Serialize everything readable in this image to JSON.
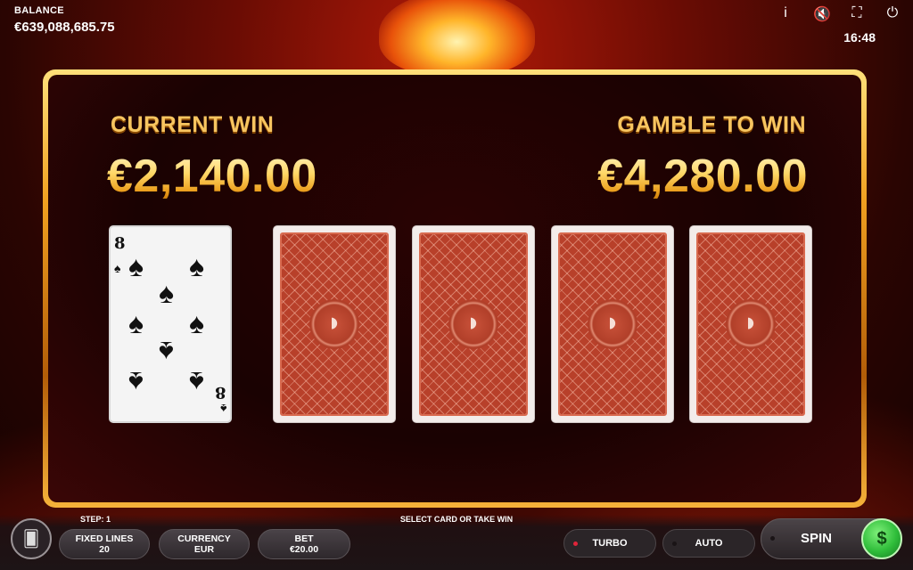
{
  "header": {
    "balance_label": "BALANCE",
    "balance_value": "€639,088,685.75",
    "clock": "16:48",
    "icons": [
      "info-icon",
      "sound-muted-icon",
      "fullscreen-icon",
      "power-icon"
    ],
    "icon_glyphs": [
      "i",
      "🔇",
      "⛶",
      "⏻"
    ]
  },
  "gamble": {
    "current_win_label": "CURRENT WIN",
    "current_win_value": "€2,140.00",
    "gamble_to_win_label": "GAMBLE TO WIN",
    "gamble_to_win_value": "€4,280.00",
    "dealer_card": {
      "rank": "8",
      "suit": "♠",
      "suit_name": "spades"
    },
    "face_down_cards": 4,
    "card_back_color": "#b8402a"
  },
  "footer": {
    "step": "STEP: 1",
    "hint": "SELECT CARD OR TAKE WIN",
    "fixed_lines_label": "FIXED LINES",
    "fixed_lines_value": "20",
    "currency_label": "CURRENCY",
    "currency_value": "EUR",
    "bet_label": "BET",
    "bet_value": "€20.00",
    "turbo_label": "TURBO",
    "auto_label": "AUTO",
    "spin_label": "SPIN",
    "turbo_dot_color": "#e0243a",
    "auto_dot_color": "#1a1416",
    "spin_dot_color": "#1a1416",
    "collect_color": "#2fbd3a"
  }
}
